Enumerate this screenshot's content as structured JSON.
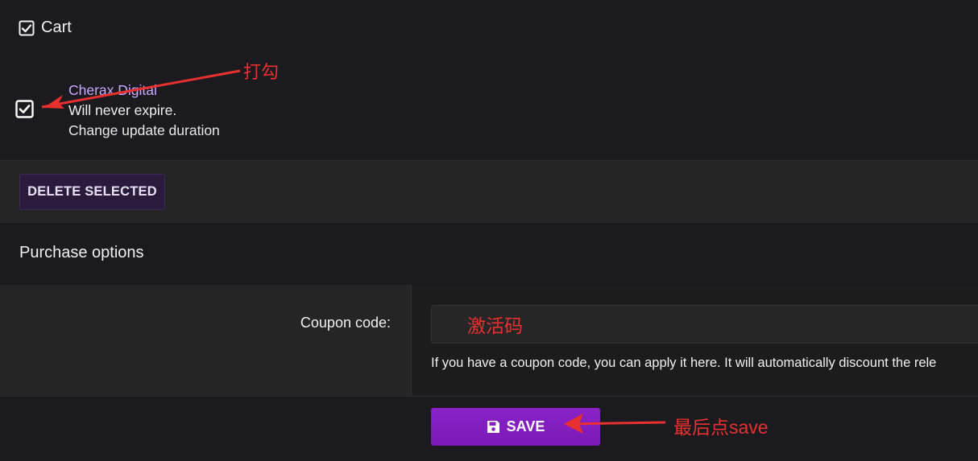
{
  "cart": {
    "title": "Cart",
    "icon": "checkbox-checked-icon"
  },
  "item": {
    "checked": true,
    "name": "Cherax",
    "name_suffix": " Digital",
    "expiry": "Will never expire.",
    "change_duration_link": "Change update duration"
  },
  "actions": {
    "delete_selected_label": "DELETE SELECTED"
  },
  "purchase_options": {
    "title": "Purchase options",
    "coupon_label": "Coupon code:",
    "coupon_value": "",
    "coupon_placeholder": "",
    "coupon_help": "If you have a coupon code, you can apply it here. It will automatically discount the rele"
  },
  "save": {
    "label": "SAVE",
    "icon": "floppy-disk-icon"
  },
  "annotations": {
    "check_note": "打勾",
    "coupon_note": "激活码",
    "save_note": "最后点save",
    "color": "#e8302f"
  },
  "colors": {
    "accent_purple": "#8a22c8",
    "link_purple": "#c9a8ff",
    "background": "#1b1b1f",
    "delete_button_bg": "#2a1b3d"
  }
}
